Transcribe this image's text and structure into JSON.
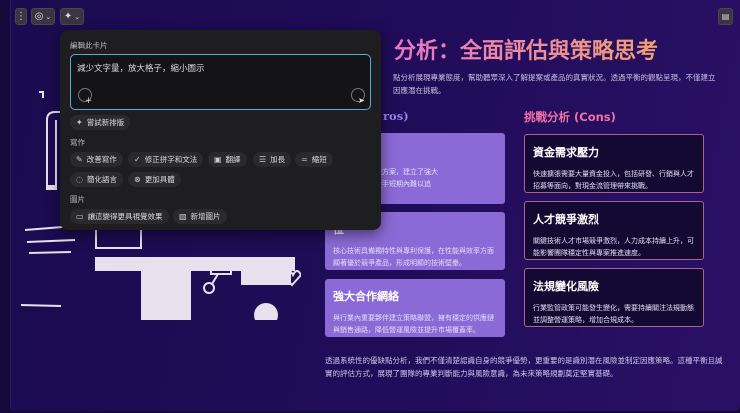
{
  "toolbar": {
    "more_icon": "⋮",
    "theme_icon": "palette-icon",
    "ai_icon": "sparkle-icon",
    "notes_icon": "notes-icon"
  },
  "slide": {
    "title": "分析：全面評估與策略思考",
    "subtitle_lines": [
      "點分析展現專業態度，幫助聽眾深入了解提案或產品的真實狀況。透過平衡的觀點呈現，不僅建立",
      "因應潛在挑戰。"
    ],
    "pros_heading": "ros)",
    "pros": [
      {
        "title": "勢",
        "desc": "先推出創新解決方案，建立了強大\n戶基礎，競爭對手短期內難以追"
      },
      {
        "title": "位",
        "desc": "核心技術具備獨特性與專利保護，在性能與效率方面顯著優於競爭產品，形成明顯的技術壁壘。"
      },
      {
        "title": "強大合作網絡",
        "desc": "與行業內重要夥伴建立策略聯盟，擁有穩定的供應鏈與銷售通路，降低營運風險並提升市場覆蓋率。"
      }
    ],
    "cons_heading": "挑戰分析 (Cons)",
    "cons": [
      {
        "title": "資金需求壓力",
        "desc": "快速擴張需要大量資金投入，包括研發、行銷與人才招募等面向，對現金流管理帶來挑戰。"
      },
      {
        "title": "人才競爭激烈",
        "desc": "關鍵技術人才市場競爭激烈，人力成本持續上升，可能影響團隊穩定性與專案推進速度。"
      },
      {
        "title": "法規變化風險",
        "desc": "行業監管政策可能發生變化，需要持續關注法規動態並調整營運策略，增加合規成本。"
      }
    ],
    "footer": "透過系統性的優缺點分析，我們不僅清楚認識自身的競爭優勢，更重要的是識別潛在風險並制定因應策略。這種平衡且誠實的評估方式，展現了團隊的專業判斷能力與風險意識，為未來策略規劃奠定堅實基礎。"
  },
  "popover": {
    "heading": "編輯此卡片",
    "input_value": "減少文字量，放大格子，縮小圖示",
    "try_layout": "嘗試新排版",
    "writing_label": "寫作",
    "writing": [
      "改善寫作",
      "修正拼字和文法",
      "翻譯",
      "加長",
      "縮短",
      "簡化語言",
      "更加具體"
    ],
    "image_label": "圖片",
    "image": [
      "讓這變得更具視覺效果",
      "新增圖片"
    ]
  }
}
